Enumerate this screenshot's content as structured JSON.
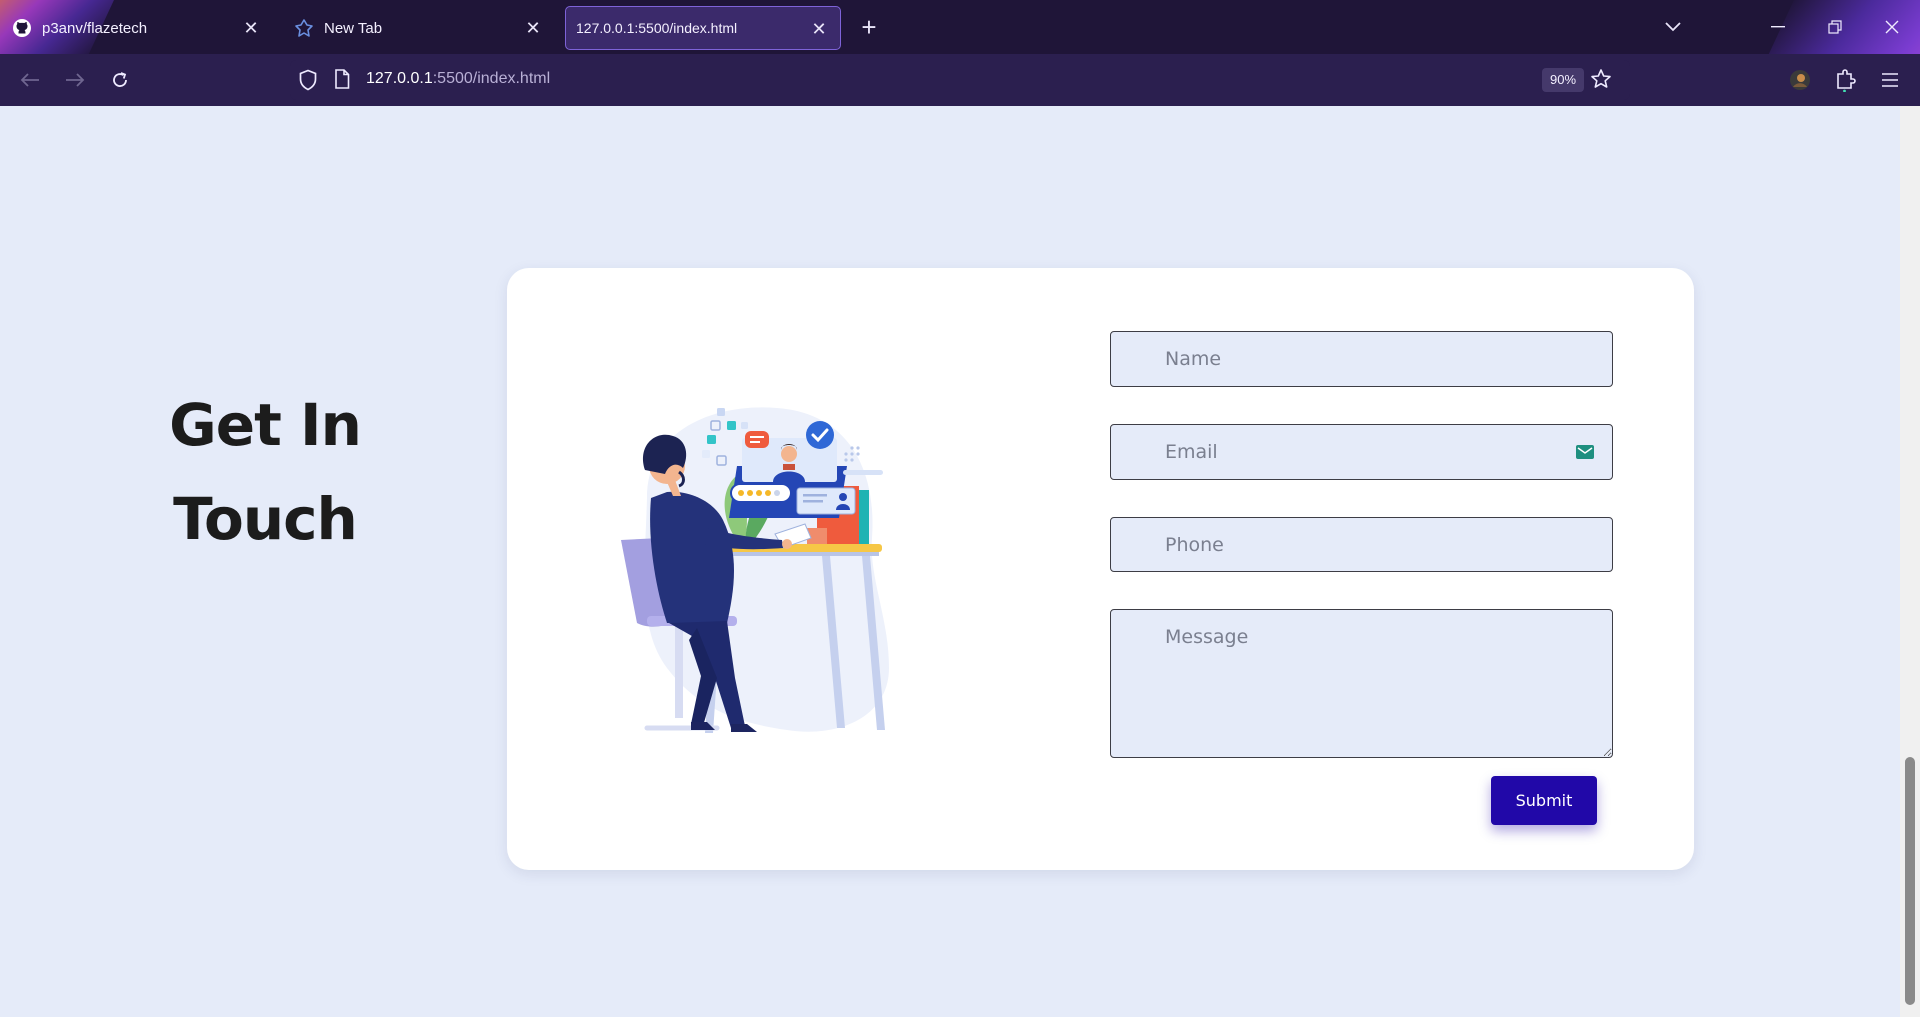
{
  "browser": {
    "tabs": [
      {
        "label": "p3anv/flazetech",
        "icon": "github-icon",
        "active": false
      },
      {
        "label": "New Tab",
        "icon": "firefox-icon",
        "active": false
      },
      {
        "label": "127.0.0.1:5500/index.html",
        "icon": "",
        "active": true
      }
    ],
    "url": {
      "host": "127.0.0.1",
      "rest": ":5500/index.html"
    },
    "zoom": "90%"
  },
  "contact": {
    "heading_line1": "Get In",
    "heading_line2": "Touch",
    "name_placeholder": "Name",
    "email_placeholder": "Email",
    "phone_placeholder": "Phone",
    "message_placeholder": "Message",
    "submit_label": "Submit",
    "illustration": "customer-support-person-at-desk",
    "button_color": "#2108a8",
    "page_background": "#e5ebf9"
  }
}
